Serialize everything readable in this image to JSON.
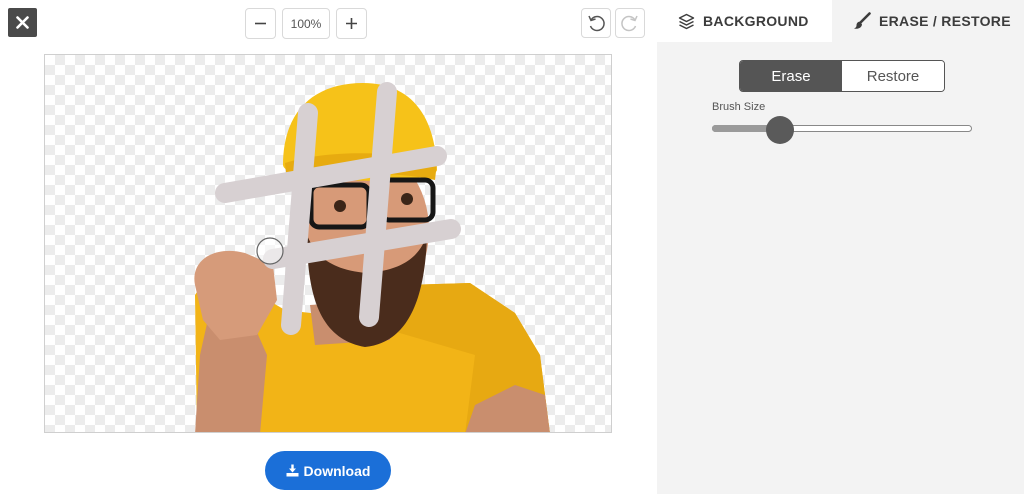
{
  "toolbar": {
    "close_icon": "close-x-icon",
    "zoom_out_icon": "minus-icon",
    "zoom_level": "100%",
    "zoom_in_icon": "plus-icon",
    "undo_icon": "undo-icon",
    "redo_icon": "redo-icon"
  },
  "download": {
    "label": "Download",
    "icon": "download-icon",
    "color": "#1b6fd8"
  },
  "panel": {
    "tabs": [
      {
        "label": "BACKGROUND",
        "icon": "layers-icon",
        "active": false
      },
      {
        "label": "ERASE / RESTORE",
        "icon": "brush-icon",
        "active": true
      }
    ],
    "mode": {
      "options": [
        "Erase",
        "Restore"
      ],
      "selected": "Erase"
    },
    "brush_size": {
      "label": "Brush Size",
      "value_fraction": 0.26
    }
  }
}
